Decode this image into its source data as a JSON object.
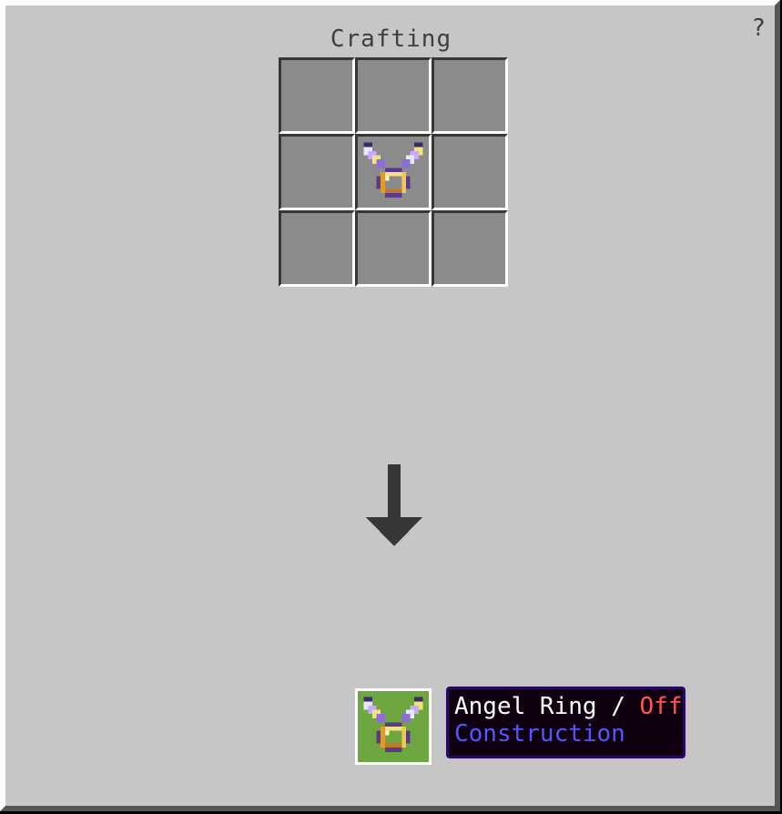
{
  "window": {
    "title": "Crafting",
    "help_glyph": "?"
  },
  "grid": {
    "slots": [
      "",
      "",
      "",
      "",
      "angel-ring-icon",
      "",
      "",
      "",
      ""
    ]
  },
  "result": {
    "item_icon": "angel-ring-icon",
    "tooltip": {
      "name": "Angel Ring",
      "separator": " / ",
      "state": "Off",
      "category": "Construction"
    }
  },
  "colors": {
    "panel": "#c6c6c6",
    "slot": "#8b8b8b",
    "result_slot": "#6ea640",
    "tooltip_bg": "#100010",
    "tooltip_border": "#2a0a5e",
    "state_off": "#ff5555",
    "category": "#5555ff"
  }
}
